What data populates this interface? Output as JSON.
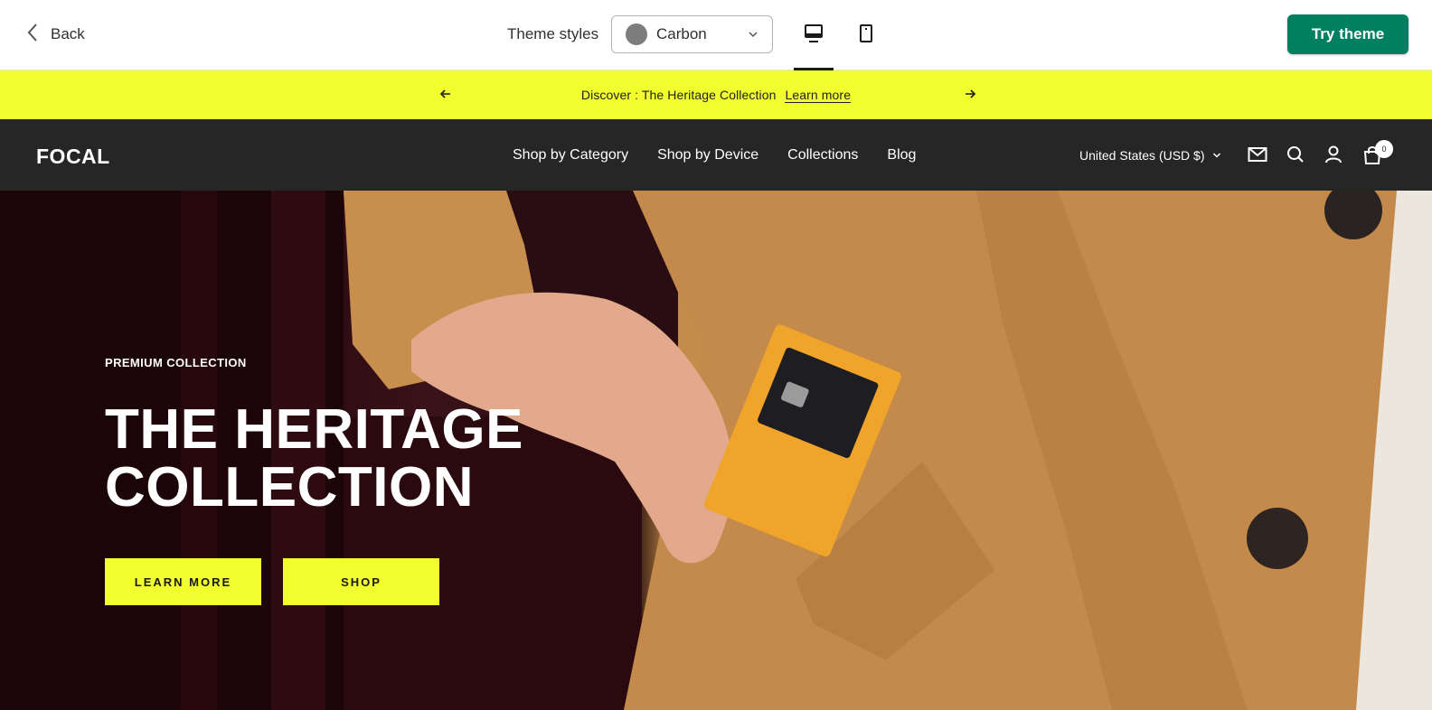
{
  "editor": {
    "back_label": "Back",
    "theme_styles_label": "Theme styles",
    "theme_select": {
      "value": "Carbon",
      "swatch_color": "#7d7d7d"
    },
    "device_toggle": {
      "selected": "desktop"
    },
    "try_theme_label": "Try theme",
    "try_theme_color": "#008060"
  },
  "announcement": {
    "text": "Discover : The Heritage Collection",
    "link": "Learn more",
    "background": "#f2ff2f"
  },
  "store": {
    "logo": "FOCAL",
    "nav": [
      "Shop by Category",
      "Shop by Device",
      "Collections",
      "Blog"
    ],
    "currency": "United States (USD $)",
    "cart_count": "0",
    "header_background": "#262626"
  },
  "hero": {
    "eyebrow": "PREMIUM COLLECTION",
    "headline_line1": "THE HERITAGE",
    "headline_line2": "COLLECTION",
    "buttons": {
      "learn_more": "LEARN MORE",
      "shop": "SHOP"
    },
    "button_color": "#f2ff2f"
  }
}
